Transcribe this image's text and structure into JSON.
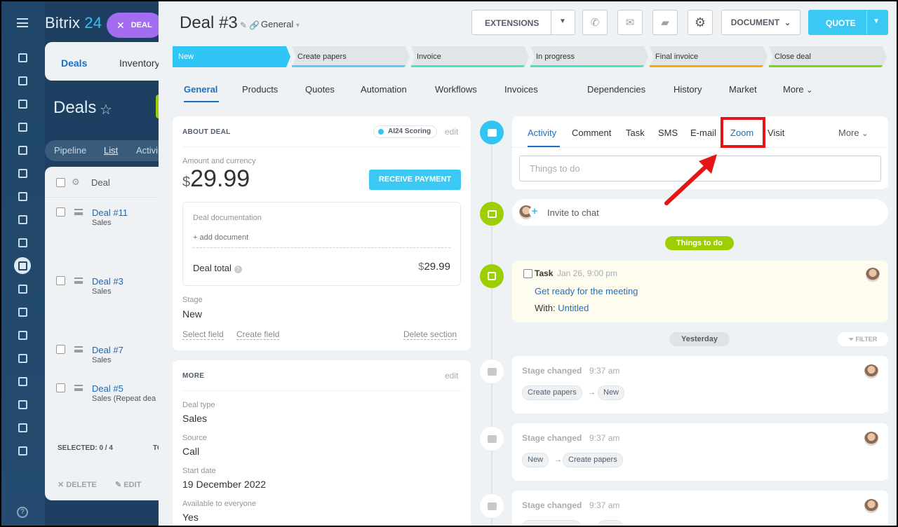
{
  "app": {
    "brand_prefix": "Bitrix",
    "brand_num": " 24"
  },
  "background": {
    "deal_pill": "DEAL",
    "tabs": [
      "Deals",
      "Inventory"
    ],
    "title": "Deals",
    "filters": [
      "Pipeline",
      "List",
      "Activi"
    ],
    "column_header": "Deal",
    "rows": [
      {
        "title": "Deal #11",
        "sub": "Sales"
      },
      {
        "title": "Deal #3",
        "sub": "Sales"
      },
      {
        "title": "Deal #7",
        "sub": "Sales"
      },
      {
        "title": "Deal #5",
        "sub": "Sales (Repeat dea"
      }
    ],
    "selected": "SELECTED: 0 / 4",
    "total_abbr": "TO",
    "delete": "DELETE",
    "edit": "EDIT"
  },
  "header": {
    "title": "Deal #3",
    "category": "General",
    "extensions": "EXTENSIONS",
    "document": "DOCUMENT",
    "quote": "QUOTE"
  },
  "stages": [
    {
      "label": "New",
      "color": "#2fc6f6",
      "active": true
    },
    {
      "label": "Create papers",
      "color": "#55d0f5",
      "active": false
    },
    {
      "label": "Invoice",
      "color": "#47e4c2",
      "active": false
    },
    {
      "label": "In progress",
      "color": "#47e4c2",
      "active": false
    },
    {
      "label": "Final invoice",
      "color": "#ffa900",
      "active": false
    },
    {
      "label": "Close deal",
      "color": "#7bd500",
      "active": false
    }
  ],
  "tabs": [
    "General",
    "Products",
    "Quotes",
    "Automation",
    "Workflows",
    "Invoices",
    "Dependencies",
    "History",
    "Market",
    "More"
  ],
  "about": {
    "title": "ABOUT DEAL",
    "ai_badge": "AI24 Scoring",
    "edit": "edit",
    "amount_label": "Amount and currency",
    "currency": "$",
    "amount": "29.99",
    "receive_payment": "RECEIVE PAYMENT",
    "doc_label": "Deal documentation",
    "add_document": "+ add document",
    "deal_total_label": "Deal total",
    "deal_total_currency": "$",
    "deal_total_value": "29.99",
    "stage_label": "Stage",
    "stage_value": "New",
    "select_field": "Select field",
    "create_field": "Create field",
    "delete_section": "Delete section"
  },
  "more": {
    "title": "MORE",
    "edit": "edit",
    "fields": [
      {
        "label": "Deal type",
        "value": "Sales"
      },
      {
        "label": "Source",
        "value": "Call"
      },
      {
        "label": "Start date",
        "value": "19 December 2022"
      },
      {
        "label": "Available to everyone",
        "value": "Yes"
      }
    ]
  },
  "composer": {
    "tabs": [
      "Activity",
      "Comment",
      "Task",
      "SMS",
      "E-mail",
      "Zoom",
      "Visit"
    ],
    "more": "More",
    "placeholder": "Things to do"
  },
  "invite": "Invite to chat",
  "things_pill": "Things to do",
  "task": {
    "label": "Task",
    "date": "Jan 26, 9:00 pm",
    "title": "Get ready for the meeting",
    "with_label": "With:",
    "with_value": "Untitled"
  },
  "yesterday_pill": "Yesterday",
  "filter": "FILTER",
  "history": [
    {
      "title": "Stage changed",
      "time": "9:37 am",
      "from": "Create papers",
      "to": "New"
    },
    {
      "title": "Stage changed",
      "time": "9:37 am",
      "from": "New",
      "to": "Create papers"
    },
    {
      "title": "Stage changed",
      "time": "9:37 am",
      "from": "",
      "to": ""
    }
  ],
  "colors": {
    "accent": "#1d6fbf",
    "cyan": "#3bc8f5",
    "green": "#9dcf00",
    "highlight": "#e41515"
  }
}
